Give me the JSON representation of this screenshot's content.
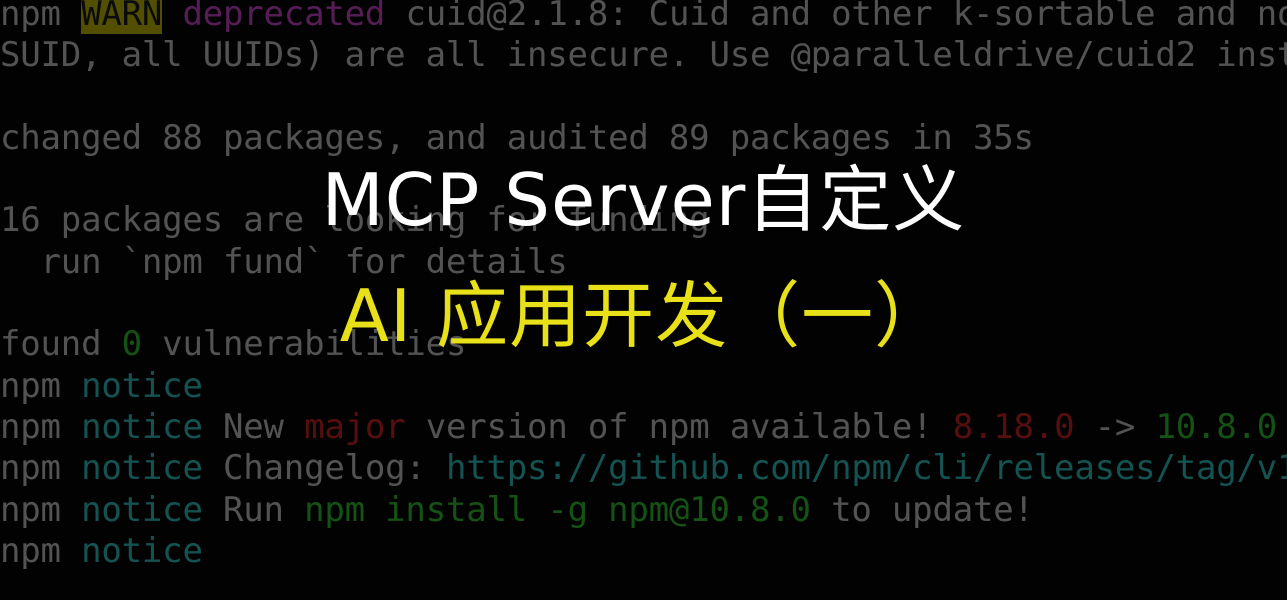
{
  "terminal": {
    "colors": {
      "default": "#b8b8b8",
      "warn_badge_bg": "#b8b000",
      "magenta": "#c040c0",
      "green": "#2fb52f",
      "cyan": "#2fb5b5",
      "red": "#c02020"
    },
    "lines": [
      {
        "segments": [
          {
            "text": "npm ",
            "color": "gray"
          },
          {
            "text": "WARN",
            "color": "warn"
          },
          {
            "text": " ",
            "color": "gray"
          },
          {
            "text": "deprecated",
            "color": "magenta"
          },
          {
            "text": " cuid@2.1.8: Cuid and other k-sortable and no",
            "color": "gray"
          }
        ]
      },
      {
        "segments": [
          {
            "text": "SUID, all UUIDs) are all insecure. Use @paralleldrive/cuid2 inst",
            "color": "gray"
          }
        ]
      },
      {
        "segments": [
          {
            "text": "",
            "color": "gray"
          }
        ]
      },
      {
        "segments": [
          {
            "text": "changed 88 packages, and audited 89 packages in 35s",
            "color": "gray"
          }
        ]
      },
      {
        "segments": [
          {
            "text": "",
            "color": "gray"
          }
        ]
      },
      {
        "segments": [
          {
            "text": "16 packages are looking for funding",
            "color": "gray"
          }
        ]
      },
      {
        "segments": [
          {
            "text": "  run `npm fund` for details",
            "color": "gray"
          }
        ]
      },
      {
        "segments": [
          {
            "text": "",
            "color": "gray"
          }
        ]
      },
      {
        "segments": [
          {
            "text": "found ",
            "color": "gray"
          },
          {
            "text": "0",
            "color": "green"
          },
          {
            "text": " vulnerabilities",
            "color": "gray"
          }
        ]
      },
      {
        "segments": [
          {
            "text": "npm ",
            "color": "gray"
          },
          {
            "text": "notice",
            "color": "cyan"
          }
        ]
      },
      {
        "segments": [
          {
            "text": "npm ",
            "color": "gray"
          },
          {
            "text": "notice",
            "color": "cyan"
          },
          {
            "text": " New ",
            "color": "gray"
          },
          {
            "text": "major",
            "color": "red"
          },
          {
            "text": " version of npm available! ",
            "color": "gray"
          },
          {
            "text": "8.18.0",
            "color": "red"
          },
          {
            "text": " -> ",
            "color": "gray"
          },
          {
            "text": "10.8.0",
            "color": "green"
          }
        ]
      },
      {
        "segments": [
          {
            "text": "npm ",
            "color": "gray"
          },
          {
            "text": "notice",
            "color": "cyan"
          },
          {
            "text": " Changelog: ",
            "color": "gray"
          },
          {
            "text": "https://github.com/npm/cli/releases/tag/v1",
            "color": "cyan"
          }
        ]
      },
      {
        "segments": [
          {
            "text": "npm ",
            "color": "gray"
          },
          {
            "text": "notice",
            "color": "cyan"
          },
          {
            "text": " Run ",
            "color": "gray"
          },
          {
            "text": "npm install -g npm@10.8.0",
            "color": "green"
          },
          {
            "text": " to update!",
            "color": "gray"
          }
        ]
      },
      {
        "segments": [
          {
            "text": "npm ",
            "color": "gray"
          },
          {
            "text": "notice",
            "color": "cyan"
          }
        ]
      }
    ]
  },
  "banner": {
    "title": "MCP Server自定义",
    "subtitle": "AI 应用开发（一）",
    "title_color": "#ffffff",
    "subtitle_color": "#e8e019"
  }
}
